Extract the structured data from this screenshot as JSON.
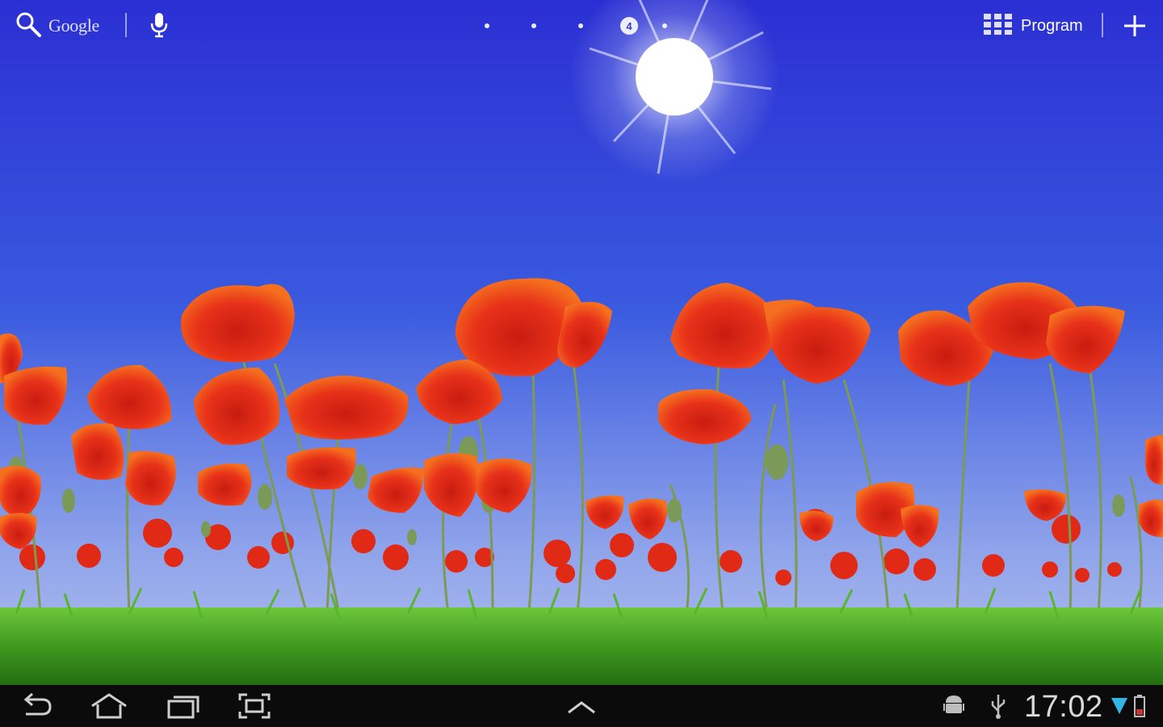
{
  "top_bar": {
    "search_label": "Google",
    "search_icon": "search-icon",
    "voice_icon": "microphone-icon",
    "current_screen": "4",
    "apps_label": "Program",
    "apps_icon": "app-grid-icon",
    "add_icon": "plus-icon"
  },
  "wallpaper": {
    "subject": "poppy field under sunny blue sky",
    "sky_top": "#2b2fd3",
    "sky_bottom": "#a7b6ec",
    "poppy_color": "#e8321a",
    "grass_color": "#3f9a1e"
  },
  "system_bar": {
    "back_icon": "back-icon",
    "home_icon": "home-icon",
    "recent_icon": "recent-apps-icon",
    "screenshot_icon": "screenshot-icon",
    "expand_icon": "chevron-up-icon",
    "android_icon": "android-icon",
    "usb_icon": "usb-icon",
    "time": "17:02",
    "wifi_icon": "wifi-icon",
    "battery_icon": "battery-icon",
    "background": "#0b0b0b"
  }
}
